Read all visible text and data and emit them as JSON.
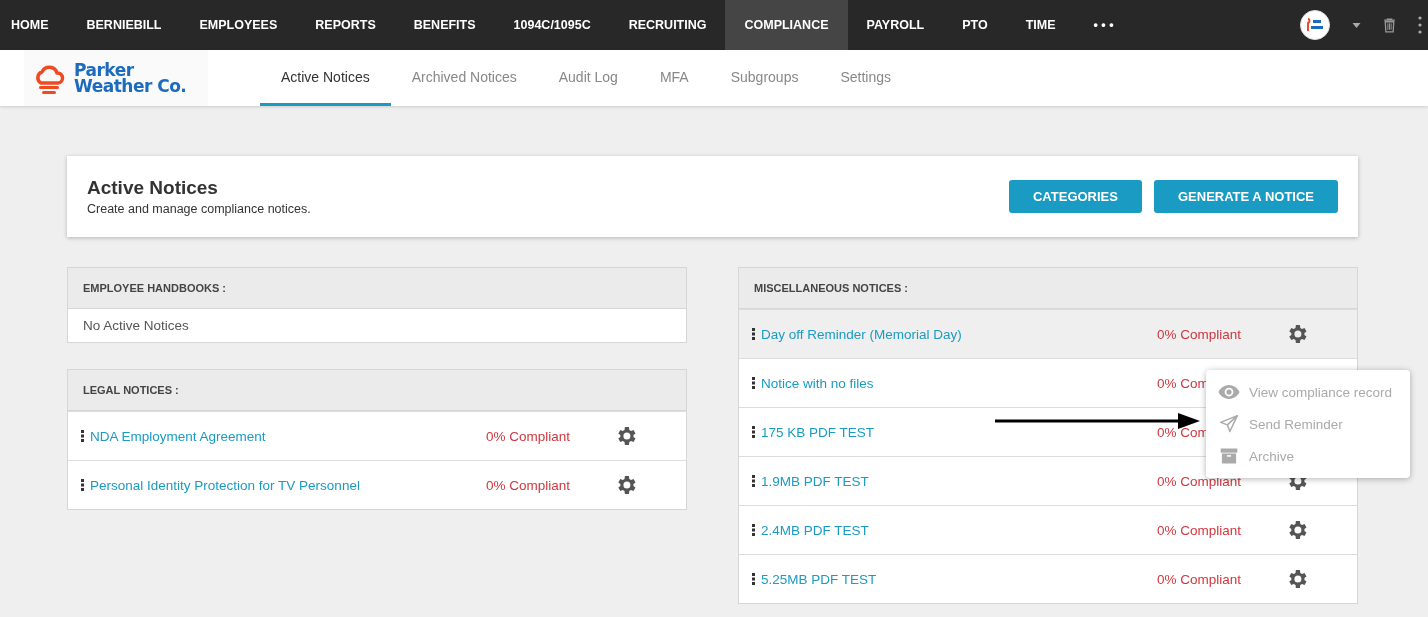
{
  "nav": {
    "items": [
      {
        "label": "HOME",
        "selected": false
      },
      {
        "label": "BERNIEBILL",
        "selected": false
      },
      {
        "label": "EMPLOYEES",
        "selected": false
      },
      {
        "label": "REPORTS",
        "selected": false
      },
      {
        "label": "BENEFITS",
        "selected": false
      },
      {
        "label": "1094C/1095C",
        "selected": false
      },
      {
        "label": "RECRUITING",
        "selected": false
      },
      {
        "label": "COMPLIANCE",
        "selected": true
      },
      {
        "label": "PAYROLL",
        "selected": false
      },
      {
        "label": "PTO",
        "selected": false
      },
      {
        "label": "TIME",
        "selected": false
      },
      {
        "label": "• • •",
        "selected": false
      }
    ]
  },
  "logo": {
    "line1": "Parker",
    "line2": "Weather Co."
  },
  "tabs": [
    {
      "label": "Active Notices",
      "selected": true
    },
    {
      "label": "Archived Notices",
      "selected": false
    },
    {
      "label": "Audit Log",
      "selected": false
    },
    {
      "label": "MFA",
      "selected": false
    },
    {
      "label": "Subgroups",
      "selected": false
    },
    {
      "label": "Settings",
      "selected": false
    }
  ],
  "header": {
    "title": "Active Notices",
    "subtitle": "Create and manage compliance notices.",
    "buttons": [
      "CATEGORIES",
      "GENERATE A NOTICE"
    ]
  },
  "left_panels": [
    {
      "title": "EMPLOYEE HANDBOOKS :",
      "empty_text": "No Active Notices"
    },
    {
      "title": "LEGAL NOTICES :",
      "rows": [
        {
          "name": "NDA Employment Agreement",
          "compliance": "0% Compliant",
          "gear": true,
          "highlighted": false
        },
        {
          "name": "Personal Identity Protection for TV Personnel",
          "compliance": "0% Compliant",
          "gear": true,
          "highlighted": false
        }
      ]
    }
  ],
  "right_panel": {
    "title": "MISCELLANEOUS NOTICES :",
    "rows": [
      {
        "name": "Day off Reminder (Memorial Day)",
        "compliance": "0% Compliant",
        "gear": true,
        "highlighted": true
      },
      {
        "name": "Notice with no files",
        "compliance": "0% Com",
        "gear": false,
        "highlighted": false
      },
      {
        "name": "175 KB PDF TEST",
        "compliance": "0% Com",
        "gear": false,
        "highlighted": false
      },
      {
        "name": "1.9MB PDF TEST",
        "compliance": "0% Compliant",
        "gear": true,
        "highlighted": false
      },
      {
        "name": "2.4MB PDF TEST",
        "compliance": "0% Compliant",
        "gear": true,
        "highlighted": false
      },
      {
        "name": "5.25MB PDF TEST",
        "compliance": "0% Compliant",
        "gear": true,
        "highlighted": false
      }
    ]
  },
  "menu": {
    "items": [
      {
        "label": "View compliance record",
        "kind": "eye"
      },
      {
        "label": "Send Reminder",
        "kind": "send"
      },
      {
        "label": "Archive",
        "kind": "archive"
      }
    ]
  }
}
